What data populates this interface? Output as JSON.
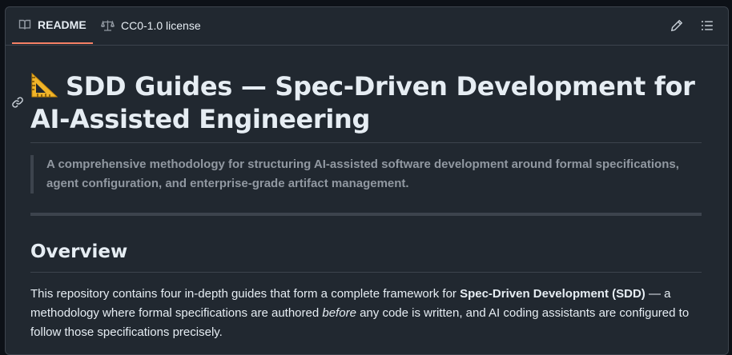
{
  "tabs": {
    "readme_label": "README",
    "license_label": "CC0-1.0 license"
  },
  "toolbar": {
    "edit_icon": "pencil-icon",
    "outline_icon": "list-unordered-icon"
  },
  "heading": {
    "emoji": "triangular-ruler",
    "title": "SDD Guides — Spec-Driven Development for AI-Assisted Engineering",
    "anchor_icon": "link-icon"
  },
  "blockquote": {
    "text": "A comprehensive methodology for structuring AI-assisted software development around formal specifications, agent configuration, and enterprise-grade artifact management."
  },
  "overview": {
    "heading": "Overview",
    "para_part1": "This repository contains four in-depth guides that form a complete framework for ",
    "para_bold": "Spec-Driven Development (SDD)",
    "para_part2": " — a methodology where formal specifications are authored ",
    "para_italic": "before",
    "para_part3": " any code is written, and AI coding assistants are configured to follow those specifications precisely."
  },
  "colors": {
    "background": "#212830",
    "border": "#3d444d",
    "text": "#e6edf3",
    "muted": "#9198a1",
    "active_tab_underline": "#f78166"
  }
}
